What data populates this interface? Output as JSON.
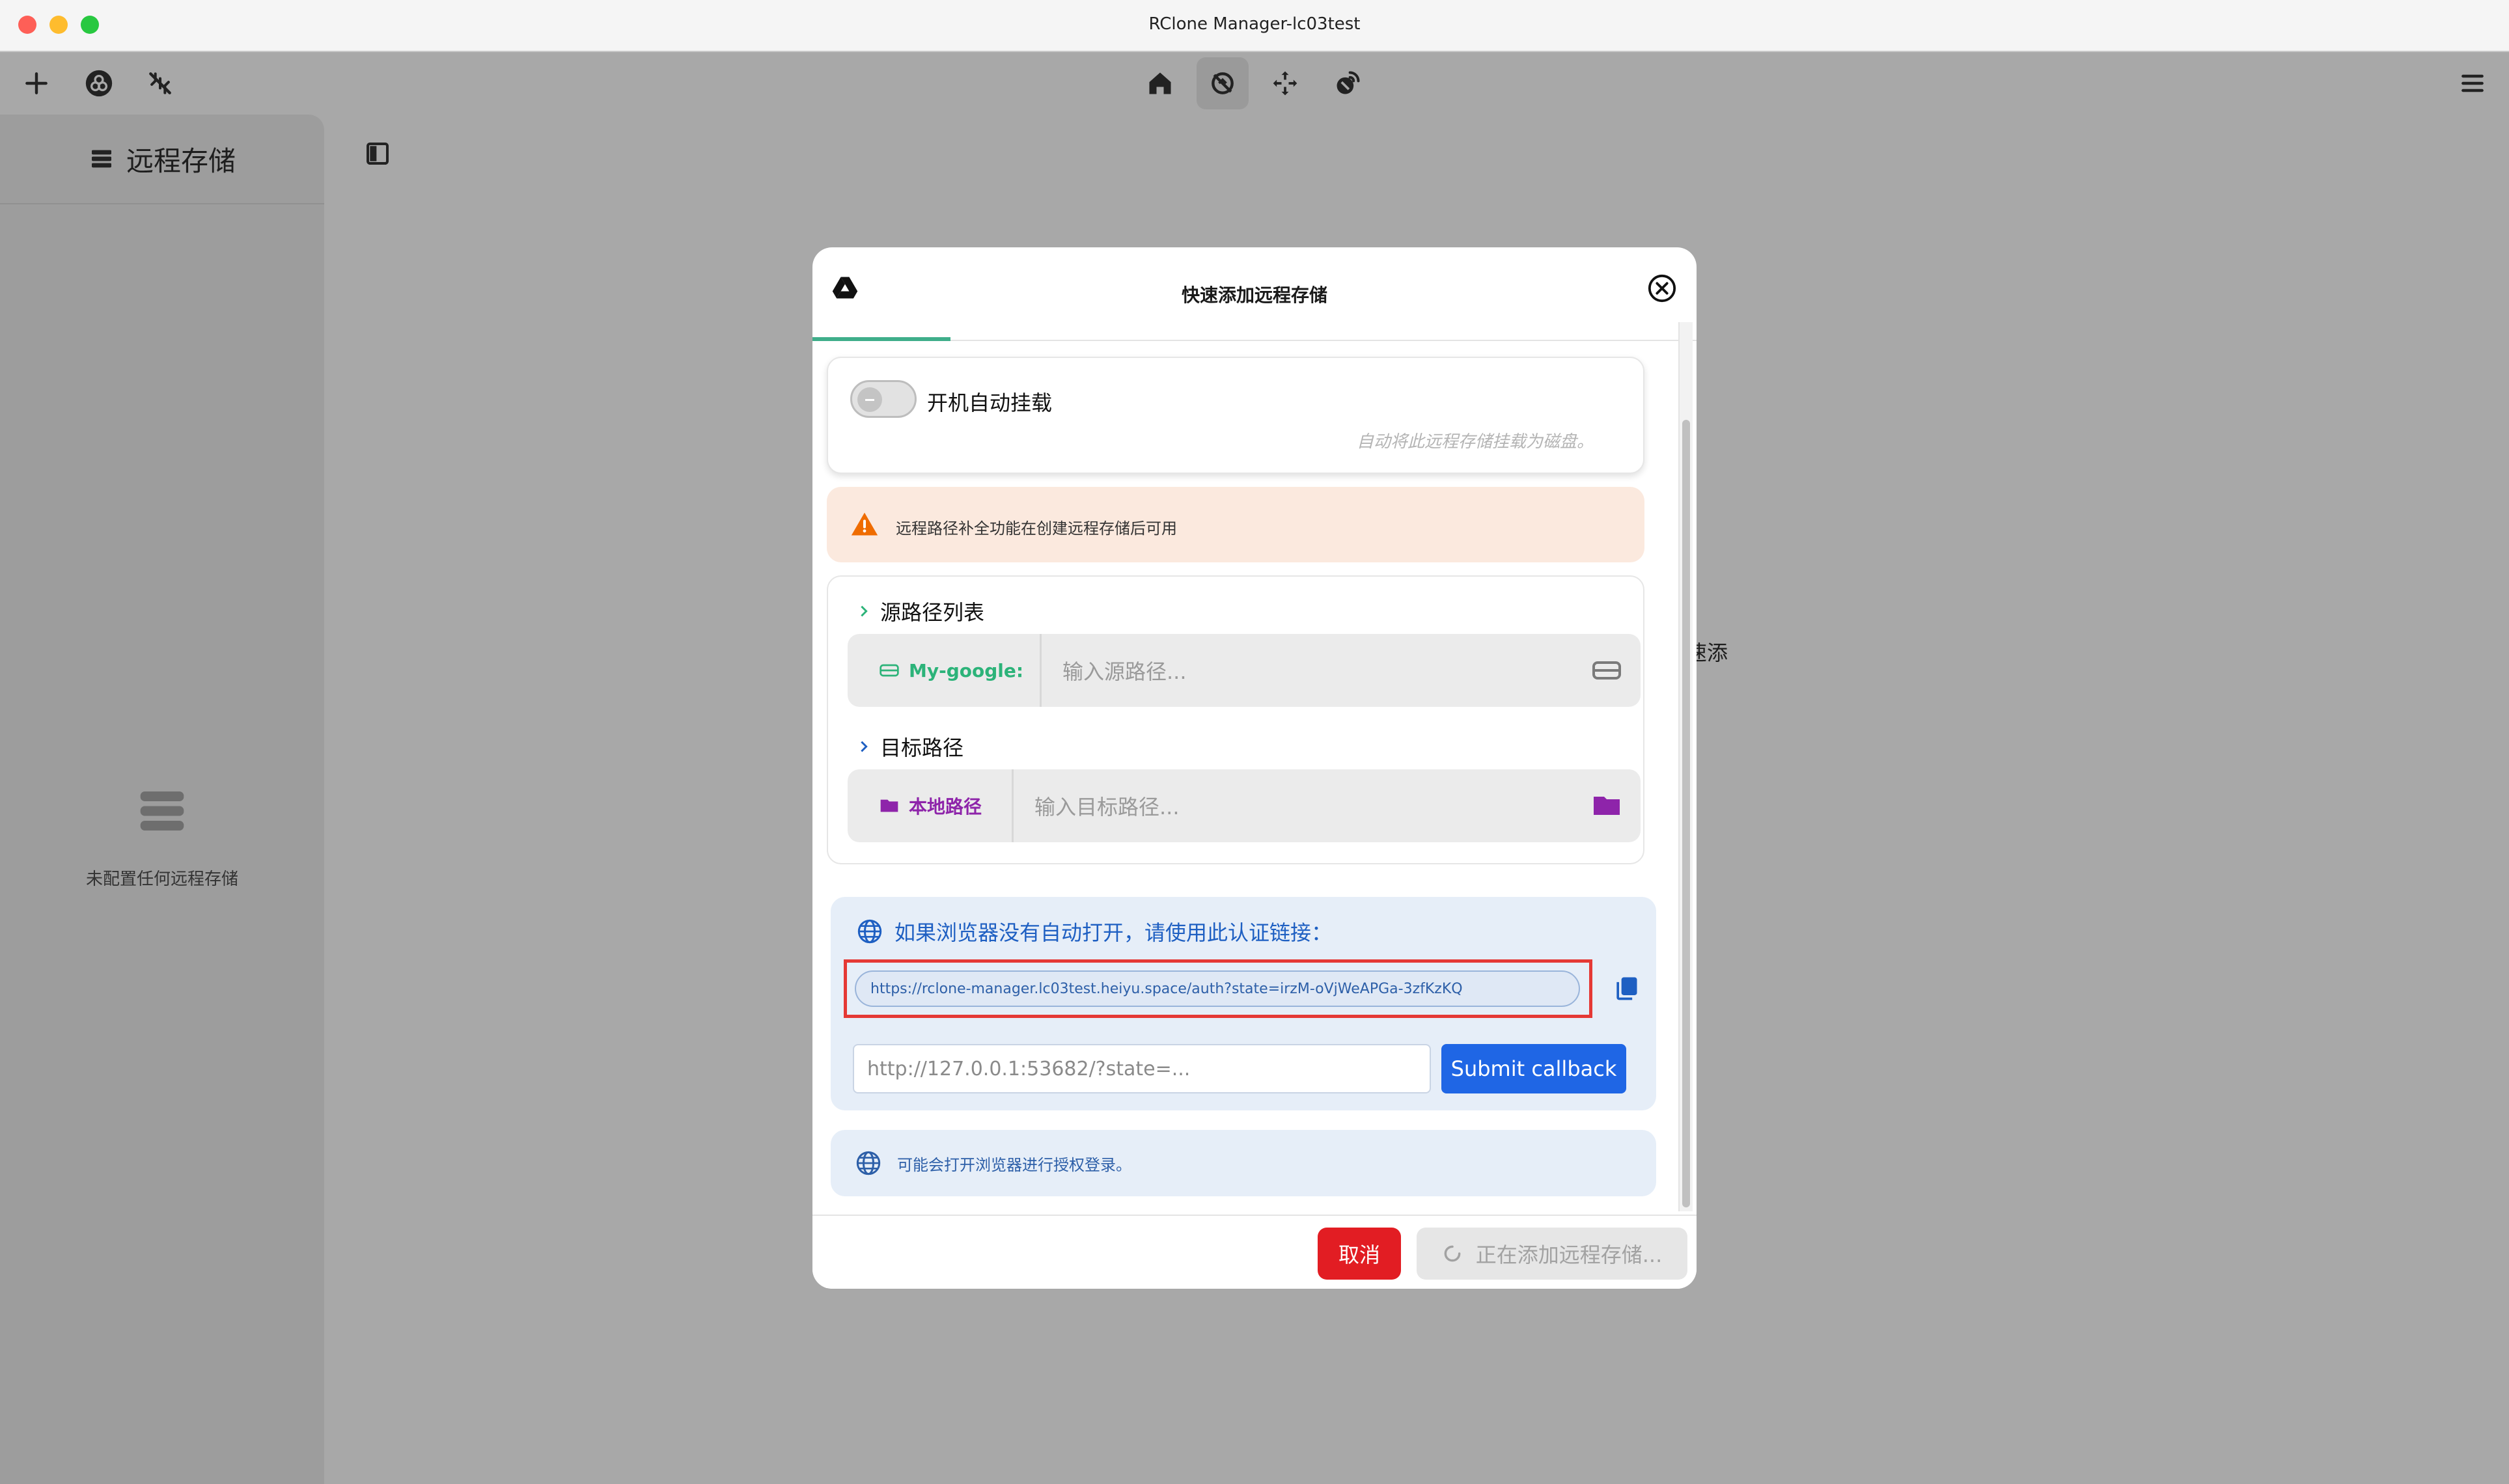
{
  "window": {
    "title": "RClone Manager-lc03test"
  },
  "toolbar": {
    "left_icons": [
      "plus-icon",
      "rclone-icon",
      "no-network-icon"
    ],
    "center_icons": [
      "home-icon",
      "sync-icon",
      "move-icon",
      "serve-icon"
    ],
    "active_center": "sync-icon",
    "right_icon": "menu-icon"
  },
  "sidebar": {
    "header_label": "远程存储",
    "empty_text": "未配置任何远程存储"
  },
  "background": {
    "partial_text": "速添"
  },
  "dialog": {
    "title": "快速添加远程存储",
    "automount": {
      "label": "开机自动挂载",
      "hint": "自动将此远程存储挂载为磁盘。",
      "enabled": false
    },
    "warning": {
      "text": "远程路径补全功能在创建远程存储后可用"
    },
    "source": {
      "section_title": "源路径列表",
      "remote_prefix": "My-google:",
      "placeholder": "输入源路径..."
    },
    "target": {
      "section_title": "目标路径",
      "prefix": "本地路径",
      "placeholder": "输入目标路径..."
    },
    "auth": {
      "heading": "如果浏览器没有自动打开，请使用此认证链接：",
      "url": "https://rclone-manager.lc03test.heiyu.space/auth?state=irzM-oVjWeAPGa-3zfKzKQ",
      "callback_placeholder": "http://127.0.0.1:53682/?state=...",
      "submit_label": "Submit callback"
    },
    "info": {
      "text": "可能会打开浏览器进行授权登录。"
    },
    "footer": {
      "cancel_label": "取消",
      "adding_label": "正在添加远程存储..."
    }
  },
  "colors": {
    "accent_green": "#3fae8a",
    "link_blue": "#1e5fc2",
    "primary_button": "#1f66e5",
    "cancel_red": "#e21d23",
    "highlight_red": "#e53935",
    "local_purple": "#8e24aa"
  }
}
